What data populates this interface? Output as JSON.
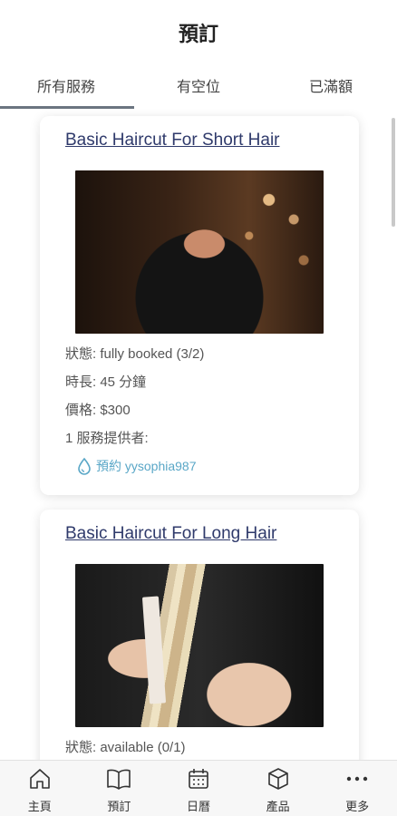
{
  "header": {
    "title": "預訂"
  },
  "tabs": [
    {
      "label": "所有服務",
      "active": true
    },
    {
      "label": "有空位",
      "active": false
    },
    {
      "label": "已滿額",
      "active": false
    }
  ],
  "services": [
    {
      "title": "Basic Haircut For Short Hair",
      "status": "狀態: fully booked (3/2)",
      "duration": "時長: 45 分鐘",
      "price": "價格: $300",
      "providers_count": "1 服務提供者:",
      "provider_link": "預約 yysophia987"
    },
    {
      "title": "Basic Haircut For Long Hair",
      "status": "狀態: available (0/1)"
    }
  ],
  "bottom_nav": [
    {
      "label": "主頁",
      "icon": "home-icon"
    },
    {
      "label": "預訂",
      "icon": "book-icon"
    },
    {
      "label": "日曆",
      "icon": "calendar-icon"
    },
    {
      "label": "產品",
      "icon": "cube-icon"
    },
    {
      "label": "更多",
      "icon": "more-icon"
    }
  ],
  "colors": {
    "link_title": "#2f3a6b",
    "provider_link": "#5aa7c7",
    "tab_indicator": "#6b7580"
  }
}
